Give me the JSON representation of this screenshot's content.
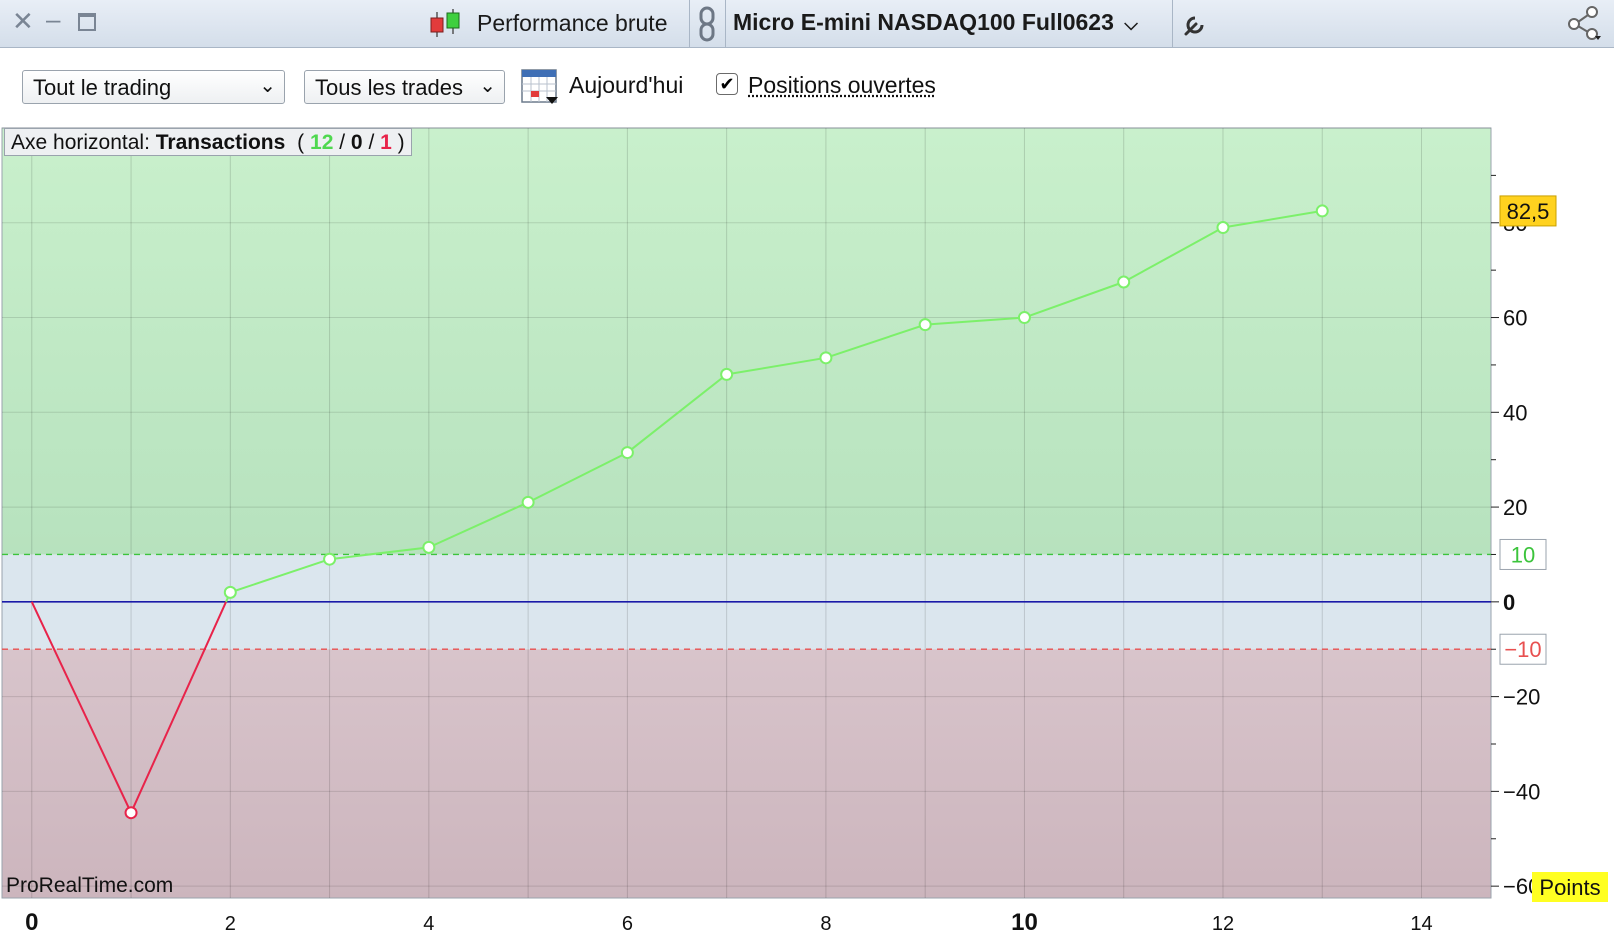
{
  "titlebar": {
    "panel_title": "Performance brute",
    "instrument": "Micro E-mini NASDAQ100 Full0623"
  },
  "toolbar": {
    "trading_select": "Tout le trading",
    "trades_select": "Tous les trades",
    "date_label": "Aujourd'hui",
    "open_positions_label": "Positions ouvertes",
    "open_positions_checked": true
  },
  "axis_badge": {
    "label": "Axe horizontal:",
    "mode": "Transactions",
    "open_paren": "(",
    "winners": "12",
    "slash1": "/",
    "neutral": "0",
    "slash2": "/",
    "losers": "1",
    "close_paren": ")"
  },
  "watermark": "ProRealTime.com",
  "colors": {
    "positive": "#7cf06a",
    "negative": "#e8234a",
    "zero_line": "#1a1aa8",
    "bg_positive": "#c4ecc8",
    "bg_neutral": "#dbe6ee",
    "bg_negative": "#d2bcc4",
    "last_value_bg": "#ffd21f",
    "unit_bg": "#ffff22"
  },
  "chart_data": {
    "type": "line",
    "x": [
      0,
      1,
      2,
      3,
      4,
      5,
      6,
      7,
      8,
      9,
      10,
      11,
      12,
      13
    ],
    "y": [
      0,
      -44.5,
      2,
      9,
      11.5,
      21,
      31.5,
      48,
      51.5,
      58.5,
      60,
      67.5,
      79,
      82.5
    ],
    "xlim": [
      -0.3,
      14.7
    ],
    "ylim": [
      -62.5,
      100
    ],
    "x_ticks": [
      {
        "v": 0,
        "label": "0",
        "bold": true
      },
      {
        "v": 2,
        "label": "2",
        "bold": false
      },
      {
        "v": 4,
        "label": "4",
        "bold": false
      },
      {
        "v": 6,
        "label": "6",
        "bold": false
      },
      {
        "v": 8,
        "label": "8",
        "bold": false
      },
      {
        "v": 10,
        "label": "10",
        "bold": true
      },
      {
        "v": 12,
        "label": "12",
        "bold": false
      },
      {
        "v": 14,
        "label": "14",
        "bold": false
      }
    ],
    "y_ticks": [
      {
        "v": 80,
        "label": "80",
        "bold": false
      },
      {
        "v": 60,
        "label": "60",
        "bold": false
      },
      {
        "v": 40,
        "label": "40",
        "bold": false
      },
      {
        "v": 20,
        "label": "20",
        "bold": false
      },
      {
        "v": 0,
        "label": "0",
        "bold": true
      },
      {
        "v": -20,
        "label": "−20",
        "bold": false
      },
      {
        "v": -40,
        "label": "−40",
        "bold": false
      },
      {
        "v": -60,
        "label": "−60",
        "bold": false
      }
    ],
    "upper_threshold": {
      "v": 10,
      "label": "10"
    },
    "lower_threshold": {
      "v": -10,
      "label": "−10"
    },
    "last_value_label": "82,5",
    "unit_label": "Points",
    "grid": true
  }
}
